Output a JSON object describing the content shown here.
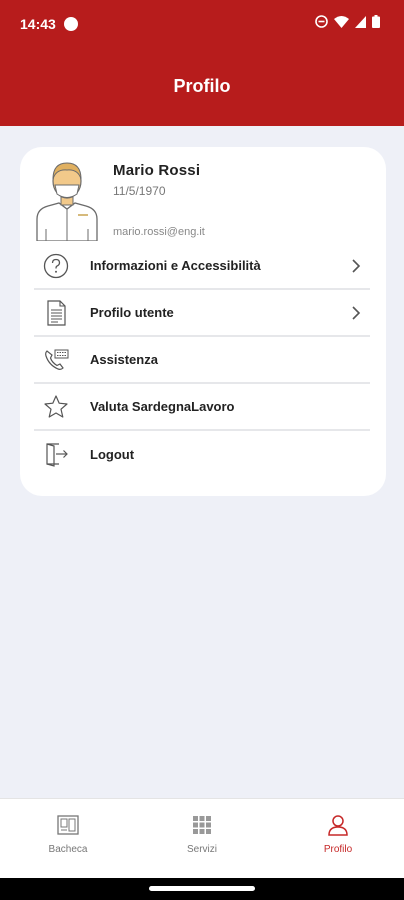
{
  "status": {
    "time": "14:43"
  },
  "header": {
    "title": "Profilo"
  },
  "profile": {
    "name": "Mario Rossi",
    "birthdate": "11/5/1970",
    "email": "mario.rossi@eng.it"
  },
  "menu": {
    "items": [
      {
        "label": "Informazioni e Accessibilità",
        "icon": "question-circle-icon",
        "chevron": true
      },
      {
        "label": "Profilo utente",
        "icon": "document-icon",
        "chevron": true
      },
      {
        "label": "Assistenza",
        "icon": "phone-icon",
        "chevron": false
      },
      {
        "label": "Valuta SardegnaLavoro",
        "icon": "star-icon",
        "chevron": false
      },
      {
        "label": "Logout",
        "icon": "logout-icon",
        "chevron": false
      }
    ]
  },
  "bottom_nav": {
    "items": [
      {
        "label": "Bacheca",
        "icon": "board-icon",
        "active": false
      },
      {
        "label": "Servizi",
        "icon": "grid-icon",
        "active": false
      },
      {
        "label": "Profilo",
        "icon": "user-icon",
        "active": true
      }
    ]
  },
  "colors": {
    "primary": "#b71c1c",
    "background": "#eef0f7",
    "active_nav": "#c62828"
  }
}
